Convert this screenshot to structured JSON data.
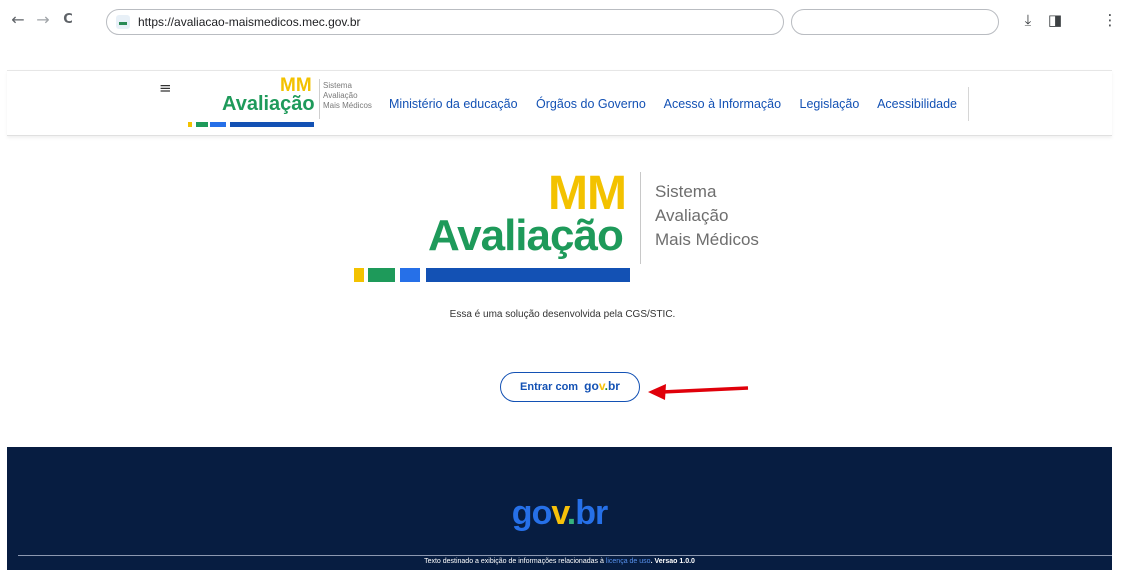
{
  "browser": {
    "back_icon": "←",
    "forward_icon": "→",
    "reload_icon": "C",
    "url": "https://avaliacao-maismedicos.mec.gov.br",
    "search_value": "",
    "download_icon": "⤓",
    "sidepanel_icon": "◨",
    "more_icon": "⋮"
  },
  "header": {
    "menu_icon": "≡",
    "logo_mm": "MM",
    "logo_avaliacao": "Avaliação",
    "logo_sub": [
      "Sistema",
      "Avaliação",
      "Mais Médicos"
    ],
    "nav": [
      "Ministério da educação",
      "Órgãos do Governo",
      "Acesso à Informação",
      "Legislação",
      "Acessibilidade"
    ]
  },
  "main": {
    "logo_mm": "MM",
    "logo_avaliacao": "Avaliação",
    "logo_sub": [
      "Sistema",
      "Avaliação",
      "Mais Médicos"
    ],
    "description": "Essa é uma solução desenvolvida pela CGS/STIC.",
    "login_label": "Entrar com",
    "login_brand": [
      "go",
      "v",
      ".",
      "br"
    ]
  },
  "footer": {
    "logo": [
      "go",
      "v",
      ".",
      "br"
    ],
    "text_before": "Texto destinado a exibição de informações relacionadas à ",
    "link": "licença de uso",
    "version": ". Versao 1.0.0"
  },
  "colors": {
    "brand_yellow": "#f3c200",
    "brand_green": "#1e9a5a",
    "gov_blue": "#1351b4",
    "footer_bg": "#071d41",
    "arrow": "#e0000a"
  }
}
